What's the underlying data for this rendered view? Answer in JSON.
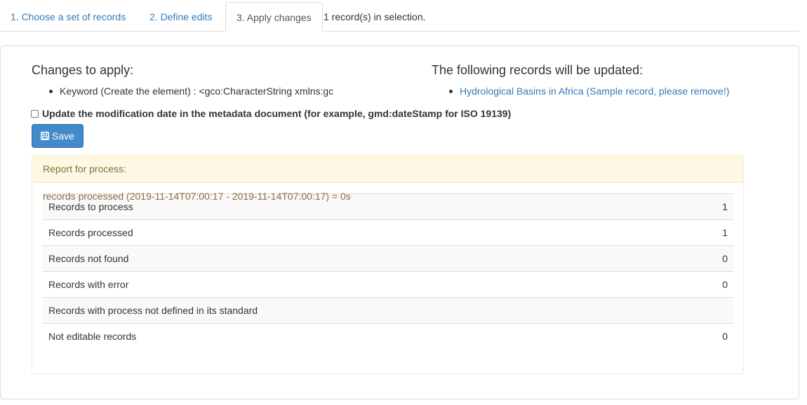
{
  "tabs": [
    {
      "label": "1. Choose a set of records"
    },
    {
      "label": "2. Define edits"
    },
    {
      "label": "3. Apply changes"
    }
  ],
  "selection_info": "1 record(s) in selection.",
  "changes": {
    "heading": "Changes to apply:",
    "items": [
      "Keyword (Create the element) : <gco:CharacterString xmlns:gc"
    ]
  },
  "records": {
    "heading": "The following records will be updated:",
    "items": [
      "Hydrological Basins in Africa (Sample record, please remove!)"
    ]
  },
  "update_date_checkbox": {
    "label": "Update the modification date in the metadata document (for example, gmd:dateStamp for ISO 19139)",
    "checked": false
  },
  "save_button": {
    "label": "Save",
    "icon": "floppy-disk-icon"
  },
  "report": {
    "heading": "Report for process:",
    "summary": "records processed (2019-11-14T07:00:17 - 2019-11-14T07:00:17) = 0s",
    "rows": [
      {
        "label": "Records to process",
        "value": "1"
      },
      {
        "label": "Records processed",
        "value": "1"
      },
      {
        "label": "Records not found",
        "value": "0"
      },
      {
        "label": "Records with error",
        "value": "0"
      },
      {
        "label": "Records with process not defined in its standard",
        "value": ""
      },
      {
        "label": "Not editable records",
        "value": "0"
      }
    ]
  }
}
